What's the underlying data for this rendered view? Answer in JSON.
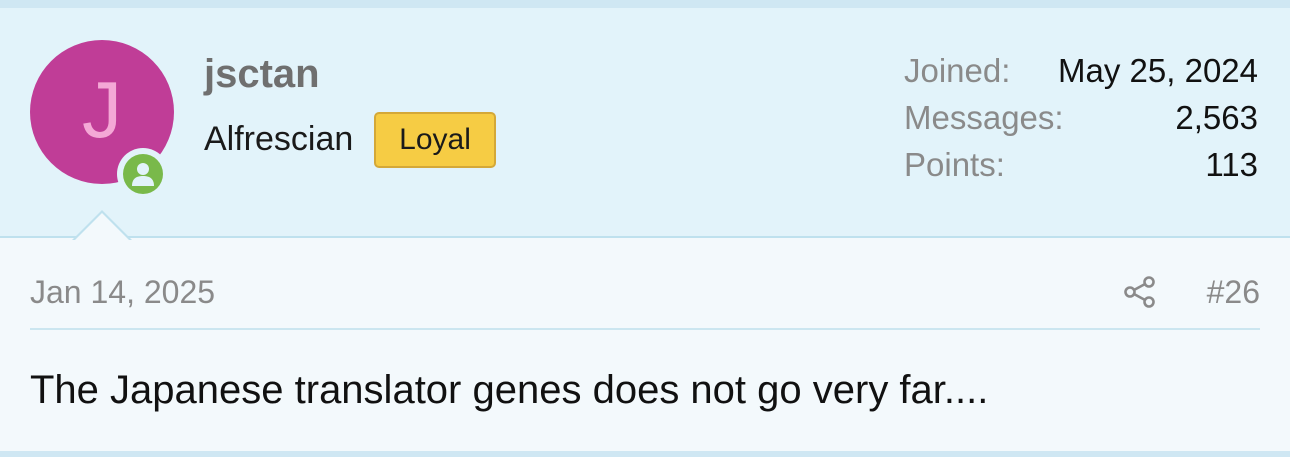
{
  "user": {
    "avatar_letter": "J",
    "username": "jsctan",
    "title": "Alfrescian",
    "badge": "Loyal",
    "online": true
  },
  "stats": [
    {
      "label": "Joined:",
      "value": "May 25, 2024"
    },
    {
      "label": "Messages:",
      "value": "2,563"
    },
    {
      "label": "Points:",
      "value": "113"
    }
  ],
  "post": {
    "date": "Jan 14, 2025",
    "number": "#26",
    "body": "The Japanese translator genes does not go very far...."
  },
  "colors": {
    "avatar_bg": "#c03d97",
    "badge_bg": "#f6cc44",
    "online_green": "#79b94a",
    "header_bg": "#e2f3fa"
  },
  "icons": {
    "share": "share-icon",
    "online": "user-online-icon"
  }
}
